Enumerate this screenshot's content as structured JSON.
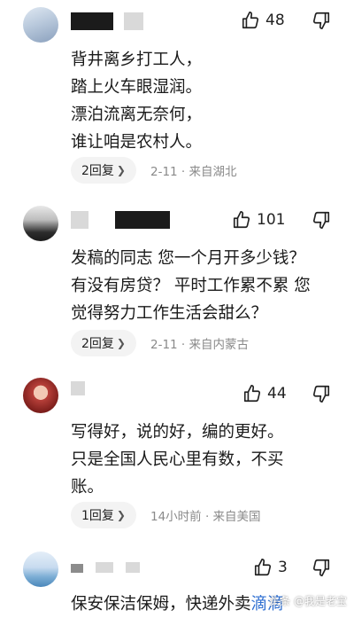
{
  "comments": [
    {
      "likes": "48",
      "text": "背井离乡打工人，\n踏上火车眼湿润。\n漂泊流离无奈何，\n谁让咱是农村人。",
      "reply_label": "2回复",
      "time": "2-11",
      "location": "来自湖北"
    },
    {
      "likes": "101",
      "text": "发稿的同志 您一个月开多少钱？\n有没有房贷？ 平时工作累不累 您\n觉得努力工作生活会甜么？",
      "reply_label": "2回复",
      "time": "2-11",
      "location": "来自内蒙古"
    },
    {
      "likes": "44",
      "text": "写得好，说的好，编的更好。\n只是全国人民心里有数，不买\n账。",
      "reply_label": "1回复",
      "time": "14小时前",
      "location": "来自美国"
    },
    {
      "likes": "3",
      "text_start": "保安保洁保姆，快递外卖",
      "text_link": "滴滴"
    }
  ],
  "watermark": "头条 @我是老宝",
  "icons": {
    "like": "thumbs-up-icon",
    "dislike": "thumbs-down-icon",
    "chevron": "chevron-right-icon"
  }
}
